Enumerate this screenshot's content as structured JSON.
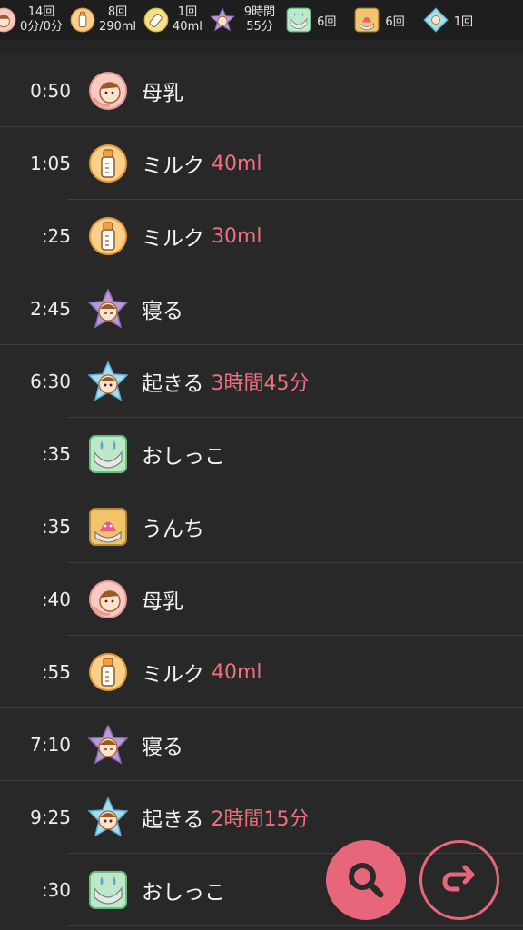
{
  "summary": {
    "breast": {
      "count": "14回",
      "duration": "0分/0分"
    },
    "milk": {
      "count": "8回",
      "amount": "290ml"
    },
    "formula": {
      "count": "1回",
      "amount": "40ml"
    },
    "sleep": {
      "duration": "9時間",
      "minutes": "55分"
    },
    "pee": {
      "count": "6回"
    },
    "poop": {
      "count": "6回"
    },
    "other": {
      "count": "1回"
    }
  },
  "entries": [
    {
      "time": "0:50",
      "icon": "breastfeeding-icon",
      "label": "母乳",
      "amount": ""
    },
    {
      "time": "1:05",
      "icon": "milk-bottle-icon",
      "label": "ミルク",
      "amount": "40ml"
    },
    {
      "time": ":25",
      "icon": "milk-bottle-icon",
      "label": "ミルク",
      "amount": "30ml"
    },
    {
      "time": "2:45",
      "icon": "sleep-icon",
      "label": "寝る",
      "amount": ""
    },
    {
      "time": "6:30",
      "icon": "wake-icon",
      "label": "起きる",
      "amount": "3時間45分"
    },
    {
      "time": ":35",
      "icon": "pee-icon",
      "label": "おしっこ",
      "amount": ""
    },
    {
      "time": ":35",
      "icon": "poop-icon",
      "label": "うんち",
      "amount": ""
    },
    {
      "time": ":40",
      "icon": "breastfeeding-icon",
      "label": "母乳",
      "amount": ""
    },
    {
      "time": ":55",
      "icon": "milk-bottle-icon",
      "label": "ミルク",
      "amount": "40ml"
    },
    {
      "time": "7:10",
      "icon": "sleep-icon",
      "label": "寝る",
      "amount": ""
    },
    {
      "time": "9:25",
      "icon": "wake-icon",
      "label": "起きる",
      "amount": "2時間15分"
    },
    {
      "time": ":30",
      "icon": "pee-icon",
      "label": "おしっこ",
      "amount": ""
    }
  ],
  "colors": {
    "accent": "#e8667a",
    "amount": "#f07080",
    "background": "#282828"
  }
}
